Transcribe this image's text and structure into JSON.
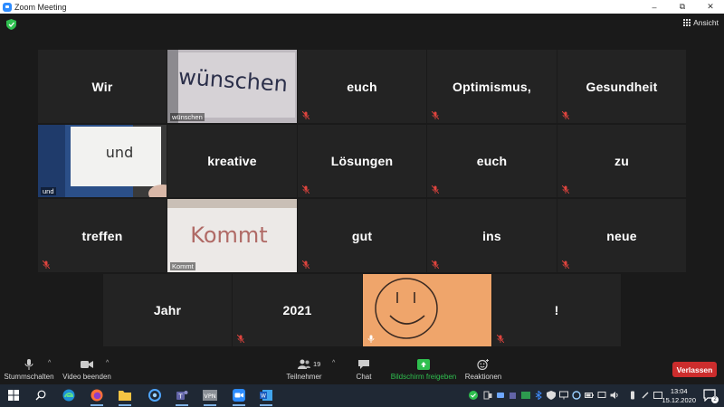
{
  "window": {
    "title": "Zoom Meeting",
    "minimize": "–",
    "restore": "⧉",
    "close": "✕"
  },
  "view_button": {
    "label": "Ansicht"
  },
  "tiles": [
    {
      "word": "Wir",
      "video": false
    },
    {
      "word": "",
      "name": "wünschen",
      "video": true,
      "active": true
    },
    {
      "word": "euch",
      "video": false,
      "muted": true
    },
    {
      "word": "Optimismus,",
      "video": false,
      "muted": true
    },
    {
      "word": "Gesundheit",
      "video": false,
      "muted": true
    },
    {
      "word": "",
      "name": "und",
      "video": true
    },
    {
      "word": "kreative",
      "video": false
    },
    {
      "word": "Lösungen",
      "video": false,
      "muted": true
    },
    {
      "word": "euch",
      "video": false,
      "muted": true
    },
    {
      "word": "zu",
      "video": false,
      "muted": true
    },
    {
      "word": "treffen",
      "video": false,
      "muted": true
    },
    {
      "word": "",
      "name": "Kommt",
      "video": true
    },
    {
      "word": "gut",
      "video": false,
      "muted": true
    },
    {
      "word": "ins",
      "video": false,
      "muted": true
    },
    {
      "word": "neue",
      "video": false,
      "muted": true
    },
    {
      "word": "Jahr",
      "video": false
    },
    {
      "word": "2021",
      "video": false,
      "muted": true
    },
    {
      "word": "",
      "video": true,
      "smiley": true
    },
    {
      "word": "!",
      "video": false,
      "muted": true
    }
  ],
  "video_text": {
    "wuenschen": "wünschen",
    "und": "und",
    "kommt": "Kommt"
  },
  "toolbar": {
    "mute_label": "Stummschalten",
    "video_label": "Video beenden",
    "participants_label": "Teilnehmer",
    "participants_count": "19",
    "chat_label": "Chat",
    "share_label": "Bildschirm freigeben",
    "reactions_label": "Reaktionen",
    "leave_label": "Verlassen"
  },
  "colors": {
    "share_green": "#2fbf4f",
    "leave_red": "#cc2d2d",
    "active_speaker": "#a6d93a",
    "muted_red": "#e0443e"
  },
  "taskbar": {
    "time": "13:04",
    "date": "15.12.2020",
    "notification_count": "2",
    "vpn_label": "VPN",
    "apps": [
      "windows-start",
      "search",
      "edge",
      "firefox",
      "file-explorer",
      "browser",
      "teams",
      "vpn",
      "zoom",
      "word"
    ]
  }
}
